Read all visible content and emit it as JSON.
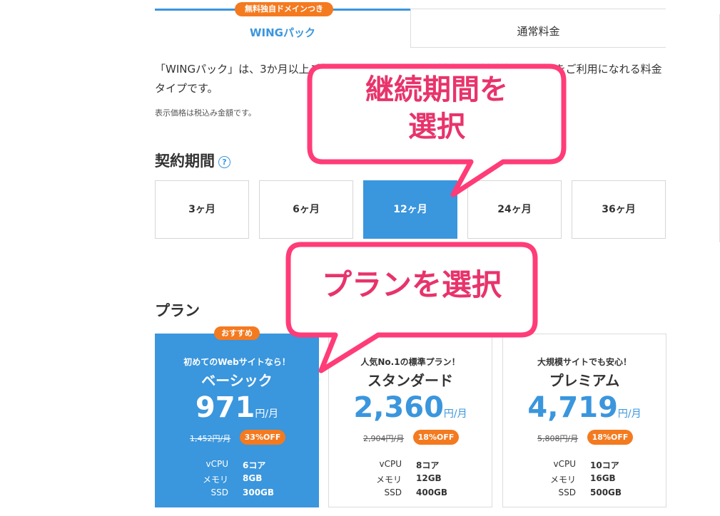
{
  "tabs": {
    "active": {
      "label": "WINGパック",
      "badge": "無料独自ドメインつき"
    },
    "inactive": {
      "label": "通常料金"
    }
  },
  "description": "「WINGパック」は、3か月以上ご契約することで、お得な料金と無料独自ドメインをご利用になれる料金タイプです。",
  "tax_note": "表示価格は税込み金額です。",
  "period_section": {
    "title": "契約期間",
    "help_icon": "question-circle-icon",
    "options": [
      "3ヶ月",
      "6ヶ月",
      "12ヶ月",
      "24ヶ月",
      "36ヶ月"
    ],
    "selected": "12ヶ月"
  },
  "plan_section": {
    "title": "プラン",
    "recommend_badge": "おすすめ",
    "plans": [
      {
        "tag": "初めてのWebサイトなら！",
        "name": "ベーシック",
        "price": "971",
        "unit": "円/月",
        "original": "1,452円/月",
        "discount": "33%OFF",
        "specs": [
          {
            "k": "vCPU",
            "v": "6コア"
          },
          {
            "k": "メモリ",
            "v": "8GB"
          },
          {
            "k": "SSD",
            "v": "300GB"
          }
        ]
      },
      {
        "tag": "人気No.1の標準プラン！",
        "name": "スタンダード",
        "price": "2,360",
        "unit": "円/月",
        "original": "2,904円/月",
        "discount": "18%OFF",
        "specs": [
          {
            "k": "vCPU",
            "v": "8コア"
          },
          {
            "k": "メモリ",
            "v": "12GB"
          },
          {
            "k": "SSD",
            "v": "400GB"
          }
        ]
      },
      {
        "tag": "大規模サイトでも安心！",
        "name": "プレミアム",
        "price": "4,719",
        "unit": "円/月",
        "original": "5,808円/月",
        "discount": "18%OFF",
        "specs": [
          {
            "k": "vCPU",
            "v": "10コア"
          },
          {
            "k": "メモリ",
            "v": "16GB"
          },
          {
            "k": "SSD",
            "v": "500GB"
          }
        ]
      }
    ],
    "selected": "ベーシック"
  },
  "callouts": {
    "period_line1": "継続期間を",
    "period_line2": "選択",
    "plan": "プランを選択"
  },
  "colors": {
    "accent": "#3a96dd",
    "orange": "#f47a20",
    "callout": "#ff3c78",
    "callout_text": "#e8336b"
  }
}
